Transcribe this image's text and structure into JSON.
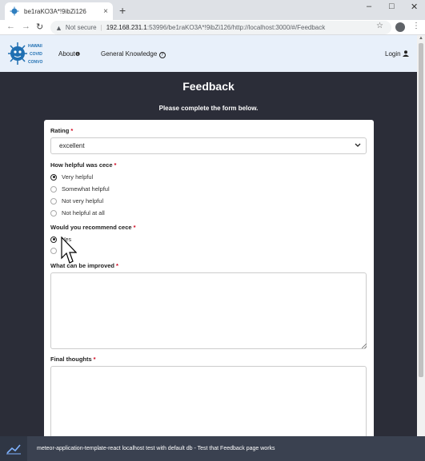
{
  "browser": {
    "tab_title": "be1raKO3A*!9ibZi126",
    "close_glyph": "×",
    "new_tab_glyph": "+",
    "minimize_glyph": "–",
    "maximize_glyph": "□",
    "window_close_glyph": "✕",
    "back_glyph": "←",
    "forward_glyph": "→",
    "reload_glyph": "↻",
    "warning_glyph": "▲",
    "not_secure": "Not secure",
    "url_separator": "|",
    "url_host": "192.168.231.1",
    "url_path": ":53996/be1raKO3A*!9ibZi126/http://localhost:3000/#/Feedback",
    "star_glyph": "☆",
    "menu_glyph": "⋮"
  },
  "navbar": {
    "logo_lines": [
      "HAWAII",
      "COVID",
      "CONVO"
    ],
    "about": "About",
    "about_icon": "❶",
    "general_knowledge": "General Knowledge",
    "gk_icon": "?",
    "login": "Login",
    "login_icon": "person-icon"
  },
  "page": {
    "title": "Feedback",
    "subtitle": "Please complete the form below."
  },
  "form": {
    "required_mark": "*",
    "rating_label": "Rating",
    "rating_value": "excellent",
    "chevron": "⌄",
    "helpful_label": "How helpful was cece",
    "helpful_options": [
      "Very helpful",
      "Somewhat helpful",
      "Not very helpful",
      "Not helpful at all"
    ],
    "helpful_selected": 0,
    "recommend_label": "Would you recommend cece",
    "recommend_options": [
      "Yes",
      ""
    ],
    "recommend_selected": 0,
    "improve_label": "What can be improved",
    "improve_value": "",
    "final_label": "Final thoughts",
    "final_value": ""
  },
  "taskbar": {
    "text": "meteor-application-template-react localhost test with default db - Test that Feedback page works"
  },
  "colors": {
    "page_bg": "#2b2d38",
    "navbar_bg": "#e8f0fa",
    "required": "#d0021b",
    "taskbar": "#3a4150"
  }
}
